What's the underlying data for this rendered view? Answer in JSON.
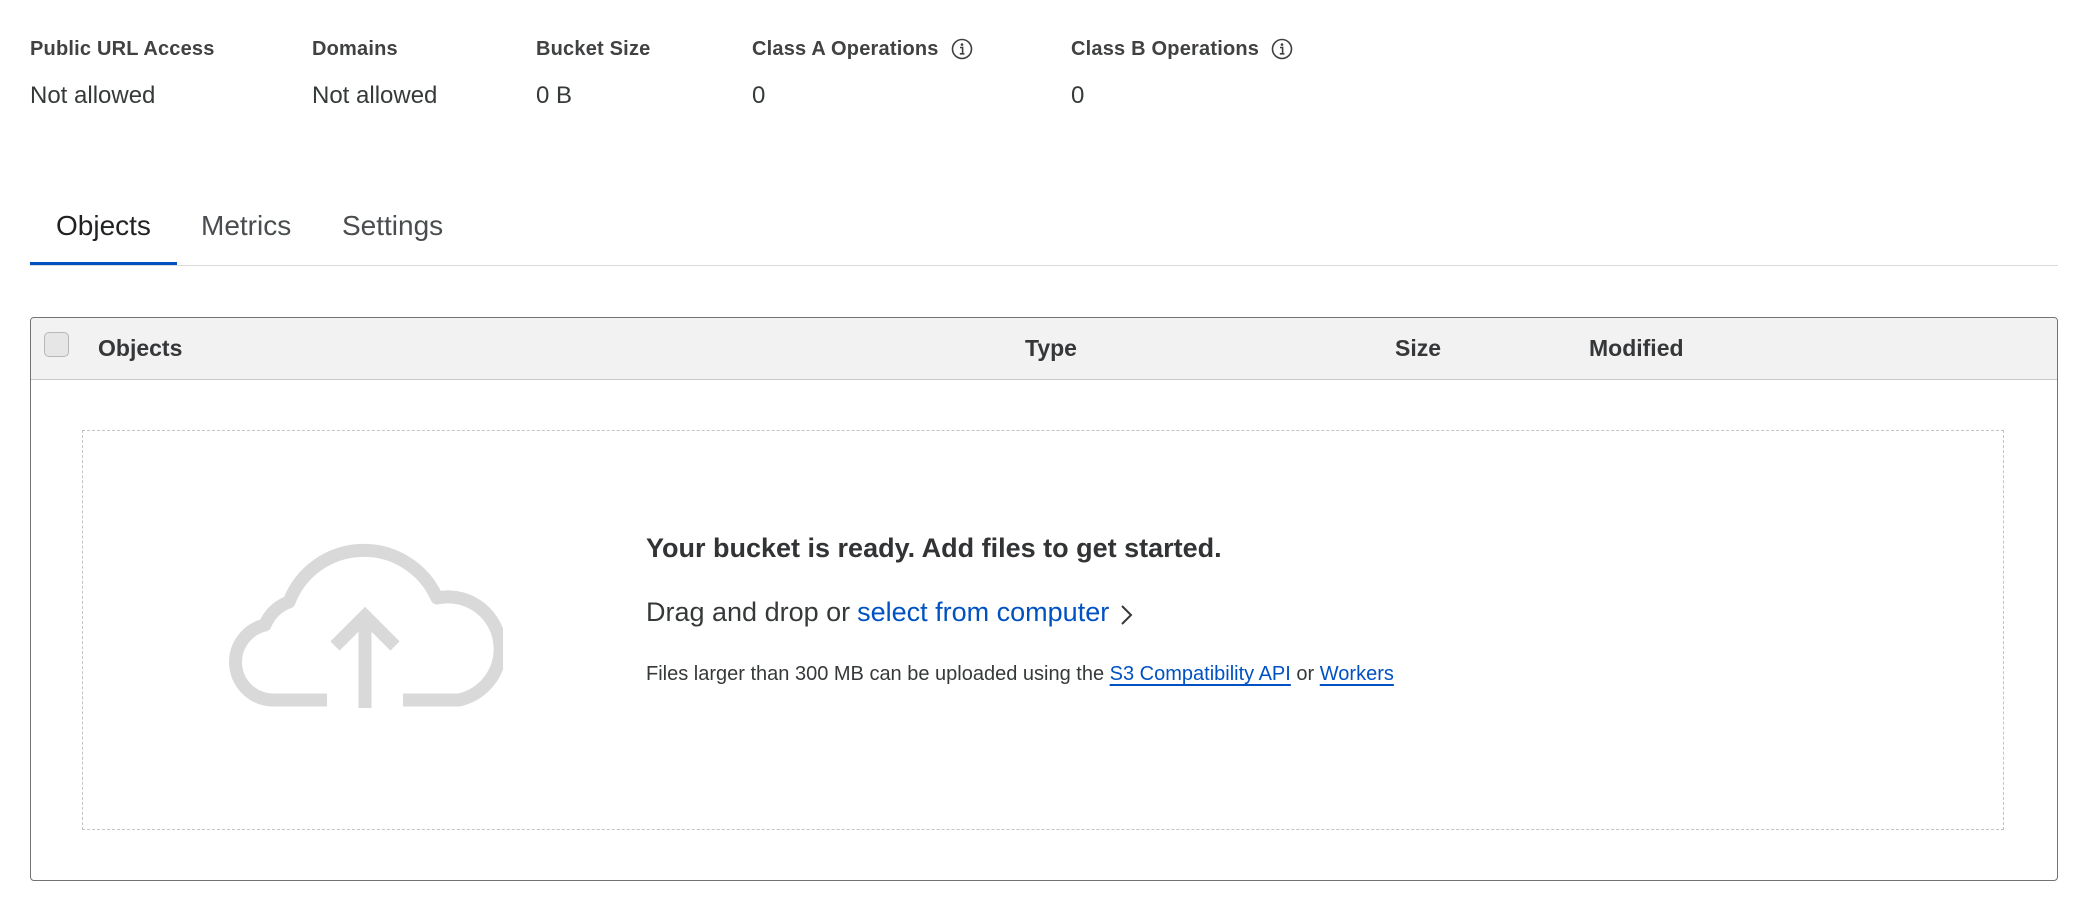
{
  "stats": [
    {
      "label": "Public URL Access",
      "value": "Not allowed",
      "info": false
    },
    {
      "label": "Domains",
      "value": "Not allowed",
      "info": false
    },
    {
      "label": "Bucket Size",
      "value": "0 B",
      "info": false
    },
    {
      "label": "Class A Operations",
      "value": "0",
      "info": true
    },
    {
      "label": "Class B Operations",
      "value": "0",
      "info": true
    }
  ],
  "tabs": [
    {
      "label": "Objects",
      "active": true
    },
    {
      "label": "Metrics",
      "active": false
    },
    {
      "label": "Settings",
      "active": false
    }
  ],
  "table": {
    "columns": [
      "Objects",
      "Type",
      "Size",
      "Modified"
    ]
  },
  "dropzone": {
    "icon": "cloud-upload-icon",
    "title": "Your bucket is ready. Add files to get started.",
    "drag_prefix": "Drag and drop or",
    "select_link": "select from computer",
    "note_prefix": "Files larger than 300 MB can be uploaded using the",
    "s3_link": "S3 Compatibility API",
    "note_or": "or",
    "workers_link": "Workers"
  },
  "colors": {
    "accent": "#0051c3",
    "icon_gray": "#d9d9d9",
    "header_bg": "#f2f2f2"
  }
}
